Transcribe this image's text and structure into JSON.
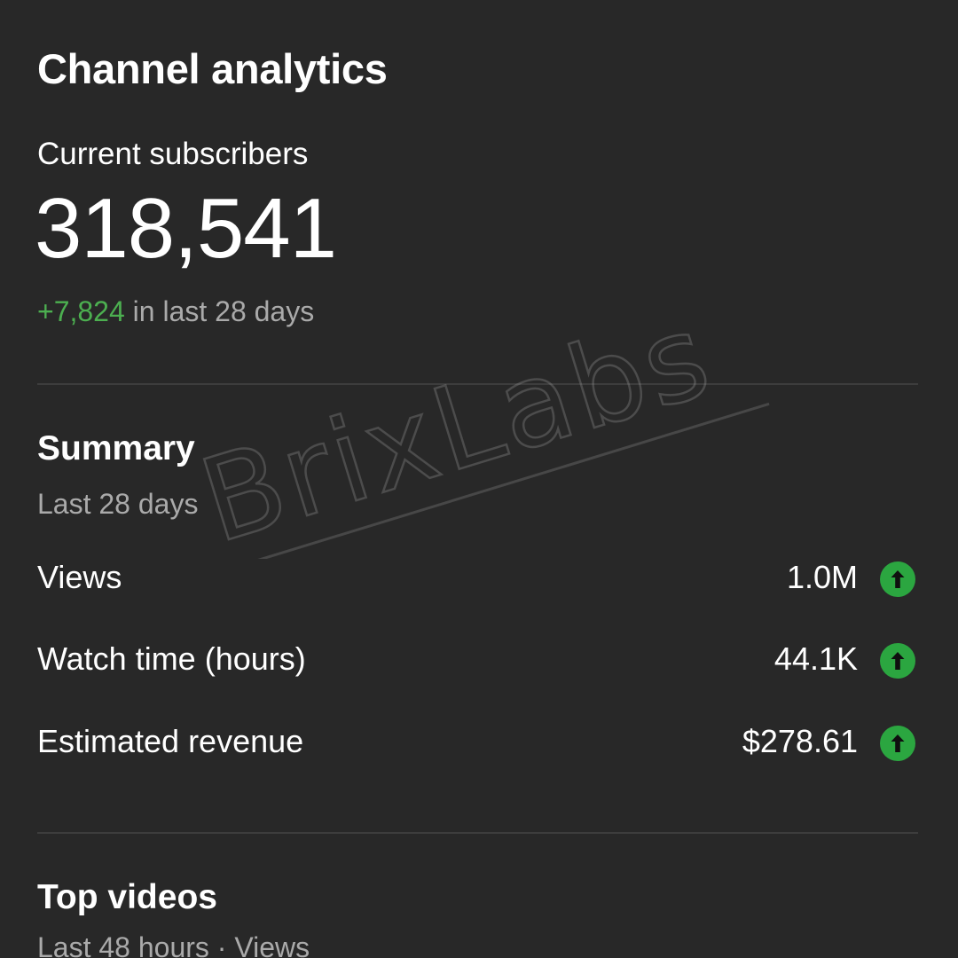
{
  "header": {
    "title": "Channel analytics"
  },
  "subscribers": {
    "label": "Current subscribers",
    "count": "318,541",
    "delta": "+7,824",
    "delta_suffix": " in last 28 days"
  },
  "summary": {
    "title": "Summary",
    "period": "Last 28 days",
    "metrics": [
      {
        "label": "Views",
        "value": "1.0M",
        "trend_icon": "arrow-up-circle-icon"
      },
      {
        "label": "Watch time (hours)",
        "value": "44.1K",
        "trend_icon": "arrow-up-circle-icon"
      },
      {
        "label": "Estimated revenue",
        "value": "$278.61",
        "trend_icon": "arrow-up-circle-icon"
      }
    ]
  },
  "top_videos": {
    "title": "Top videos",
    "period": "Last 48 hours · Views"
  },
  "watermark": {
    "text": "BrixLabs"
  },
  "colors": {
    "background": "#282828",
    "text_primary": "#ffffff",
    "text_secondary": "#aaaaaa",
    "positive": "#4caf50",
    "trend_up": "#2ba640",
    "divider": "#3d3d3d"
  }
}
